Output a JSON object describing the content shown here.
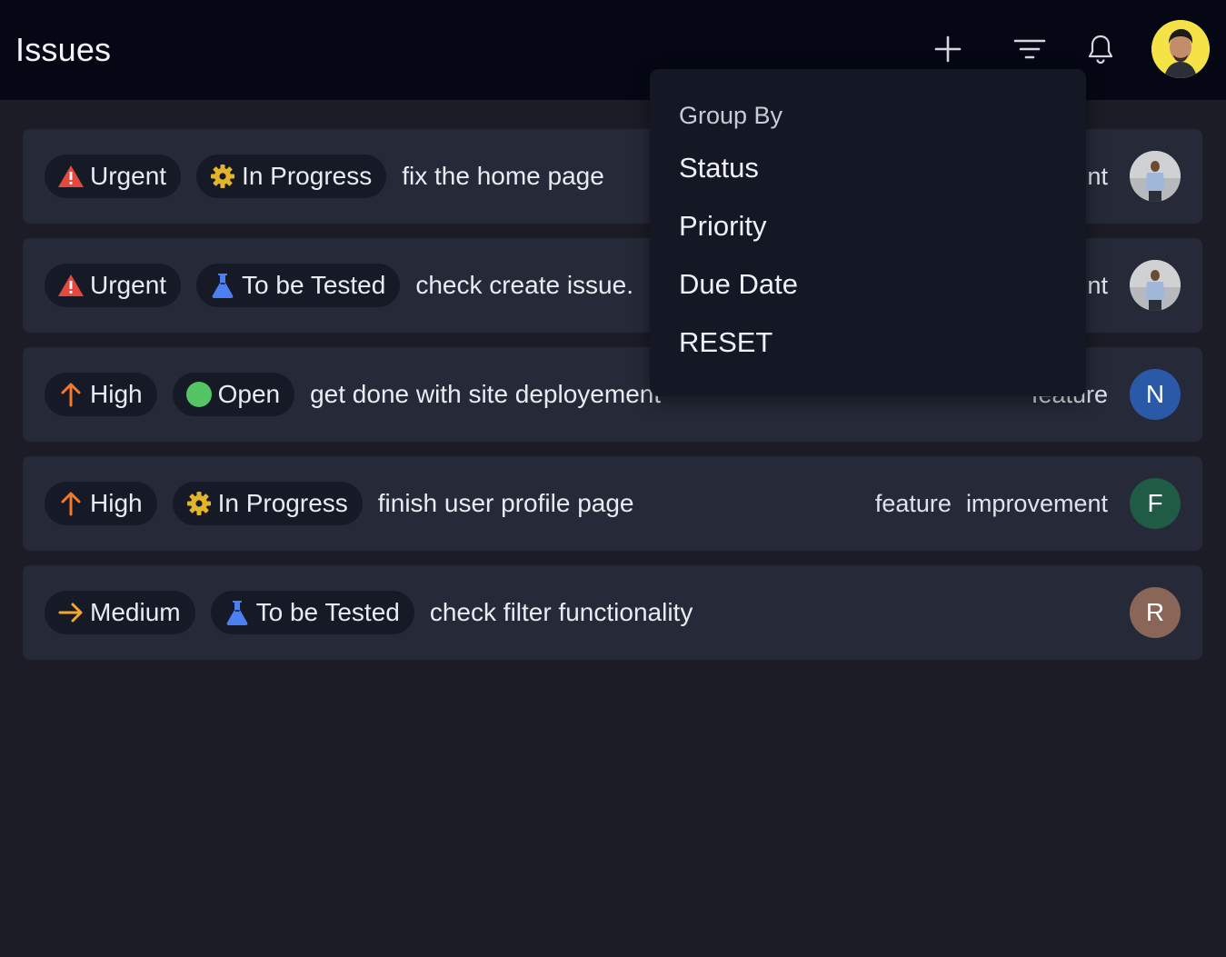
{
  "header": {
    "title": "Issues",
    "icons": [
      "plus-icon",
      "filter-icon",
      "bell-icon"
    ]
  },
  "group_by_menu": {
    "heading": "Group By",
    "options": [
      "Status",
      "Priority",
      "Due Date",
      "RESET"
    ]
  },
  "colors": {
    "urgent": "#e5483e",
    "high": "#f07a2e",
    "medium": "#f0a830",
    "in_progress": "#e2b52a",
    "to_be_tested": "#4c7ff2",
    "open": "#55c463"
  },
  "issues": [
    {
      "priority": "Urgent",
      "priority_icon": "warning-icon",
      "status": "In Progress",
      "status_icon": "gear-icon",
      "title": "fix the home page",
      "tags": [
        "nt"
      ],
      "assignee": ""
    },
    {
      "priority": "Urgent",
      "priority_icon": "warning-icon",
      "status": "To be Tested",
      "status_icon": "flask-icon",
      "title": "check create issue.",
      "tags": [
        "nt"
      ],
      "assignee": ""
    },
    {
      "priority": "High",
      "priority_icon": "arrow-up-icon",
      "status": "Open",
      "status_icon": "dot-icon",
      "title": "get done with site deployement",
      "tags": [
        "feature"
      ],
      "assignee": "N"
    },
    {
      "priority": "High",
      "priority_icon": "arrow-up-icon",
      "status": "In Progress",
      "status_icon": "gear-icon",
      "title": "finish user profile page",
      "tags": [
        "feature",
        "improvement"
      ],
      "assignee": "F"
    },
    {
      "priority": "Medium",
      "priority_icon": "arrow-right-icon",
      "status": "To be Tested",
      "status_icon": "flask-icon",
      "title": "check filter functionality",
      "tags": [],
      "assignee": "R"
    }
  ]
}
